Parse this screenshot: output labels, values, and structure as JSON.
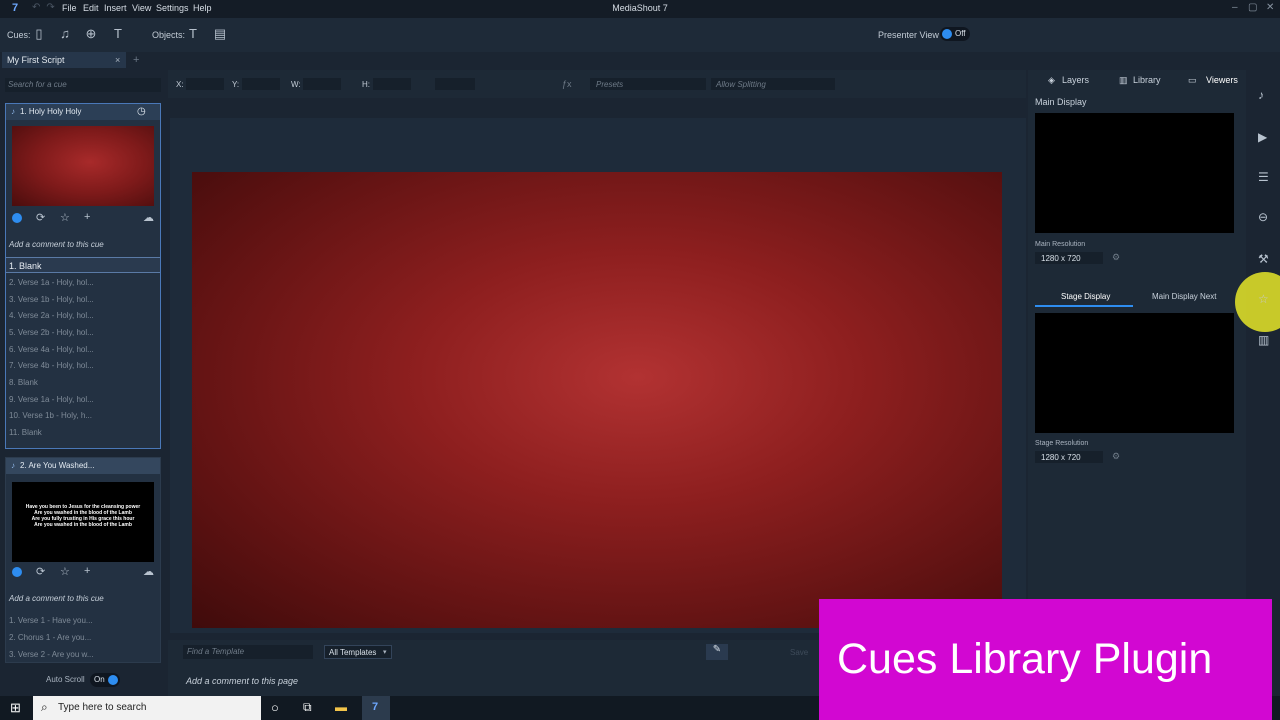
{
  "app": {
    "window_title": "MediaShout 7",
    "menu": [
      "File",
      "Edit",
      "Insert",
      "View",
      "Settings",
      "Help"
    ]
  },
  "toolbar": {
    "cues_label": "Cues:",
    "objects_label": "Objects:",
    "presenter_view_label": "Presenter View :",
    "presenter_view_state": "Off"
  },
  "script_tab": {
    "label": "My First Script",
    "close": "×",
    "add": "+"
  },
  "left_panel": {
    "search_placeholder": "Search for a cue",
    "cues": [
      {
        "title": "1.  Holy Holy Holy",
        "comment_placeholder": "Add a comment to this cue",
        "slides": [
          "1.  Blank",
          "2.  Verse 1a - Holy, hol...",
          "3.  Verse 1b - Holy, hol...",
          "4.  Verse 2a - Holy, hol...",
          "5.  Verse 2b - Holy, hol...",
          "6.  Verse 4a - Holy, hol...",
          "7.  Verse 4b - Holy, hol...",
          "8.  Blank",
          "9.  Verse 1a - Holy, hol...",
          "10.  Verse 1b - Holy, h...",
          "11.  Blank"
        ]
      },
      {
        "title": "2.  Are You Washed...",
        "thumb_lines": [
          "Have you been to Jesus for the cleansing power",
          "Are you washed in the blood of the Lamb",
          "Are you fully trusting in His grace this hour",
          "Are you washed in the blood of the Lamb"
        ],
        "comment_placeholder": "Add a comment to this cue",
        "slides": [
          "1.  Verse 1 - Have you...",
          "2.  Chorus 1 - Are you...",
          "3.  Verse 2 - Are you w..."
        ]
      }
    ],
    "auto_scroll_label": "Auto Scroll",
    "auto_scroll_state": "On"
  },
  "prop_bar": {
    "x_label": "X:",
    "y_label": "Y:",
    "w_label": "W:",
    "h_label": "H:",
    "fx_label": "ƒx",
    "presets_label": "Presets",
    "allow_splitting_label": "Allow Splitting"
  },
  "bottom_bar": {
    "template_search_placeholder": "Find a Template",
    "template_filter": "All Templates",
    "save_label": "Save",
    "page_comment_placeholder": "Add a comment to this page"
  },
  "right_panel": {
    "tabs": [
      "Layers",
      "Library",
      "Viewers"
    ],
    "main_display_label": "Main Display",
    "main_resolution_label": "Main Resolution",
    "main_resolution_value": "1280 x 720",
    "stage_tabs": [
      "Stage Display",
      "Main Display Next"
    ],
    "stage_resolution_label": "Stage Resolution",
    "stage_resolution_value": "1280 x 720"
  },
  "taskbar": {
    "search_placeholder": "Type here to search"
  },
  "banner": {
    "text": "Cues Library Plugin",
    "color": "#d207d2"
  },
  "colors": {
    "accent": "#2e8df0",
    "slide_red": "#8e1f1f"
  }
}
